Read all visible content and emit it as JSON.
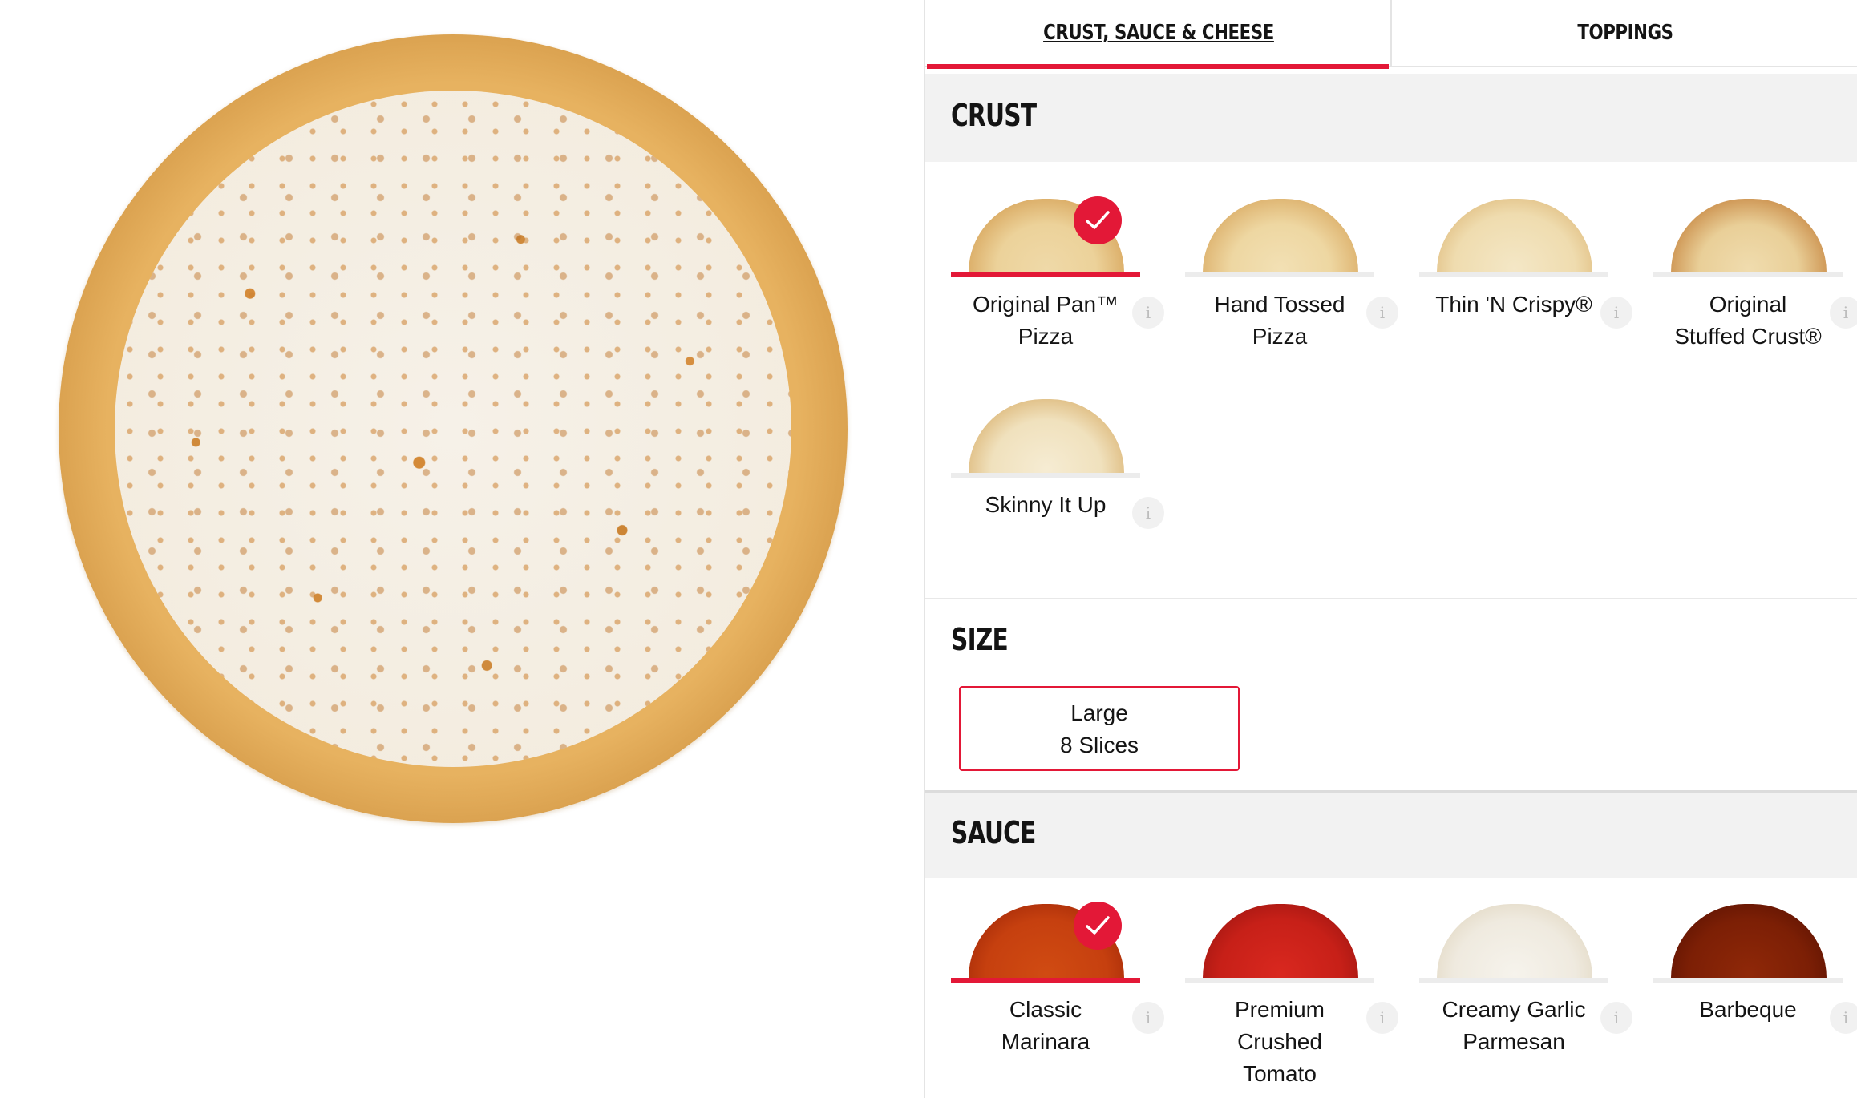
{
  "tabs": [
    {
      "label": "CRUST, SAUCE & CHEESE",
      "active": true
    },
    {
      "label": "TOPPINGS",
      "active": false
    }
  ],
  "crust": {
    "title": "CRUST",
    "options": [
      {
        "name": "Original Pan™ Pizza",
        "line1": "Original Pan™",
        "line2": "Pizza",
        "selected": true
      },
      {
        "name": "Hand Tossed Pizza",
        "line1": "Hand Tossed",
        "line2": "Pizza",
        "selected": false
      },
      {
        "name": "Thin 'N Crispy®",
        "line1": "Thin 'N Crispy®",
        "line2": "",
        "selected": false
      },
      {
        "name": "Original Stuffed Crust®",
        "line1": "Original",
        "line2": "Stuffed Crust®",
        "selected": false
      },
      {
        "name": "Skinny It Up",
        "line1": "Skinny It Up",
        "line2": "",
        "selected": false
      }
    ]
  },
  "size": {
    "title": "SIZE",
    "selected_line1": "Large",
    "selected_line2": "8 Slices"
  },
  "sauce": {
    "title": "SAUCE",
    "options": [
      {
        "name": "Classic Marinara",
        "line1": "Classic",
        "line2": "Marinara",
        "line3": "",
        "selected": true
      },
      {
        "name": "Premium Crushed Tomato",
        "line1": "Premium",
        "line2": "Crushed",
        "line3": "Tomato",
        "selected": false
      },
      {
        "name": "Creamy Garlic Parmesan",
        "line1": "Creamy Garlic",
        "line2": "Parmesan",
        "line3": "",
        "selected": false
      },
      {
        "name": "Barbeque",
        "line1": "Barbeque",
        "line2": "",
        "line3": "",
        "selected": false
      }
    ]
  },
  "info_glyph": "i",
  "colors": {
    "accent": "#e31837",
    "section_bg": "#f2f2f2"
  }
}
